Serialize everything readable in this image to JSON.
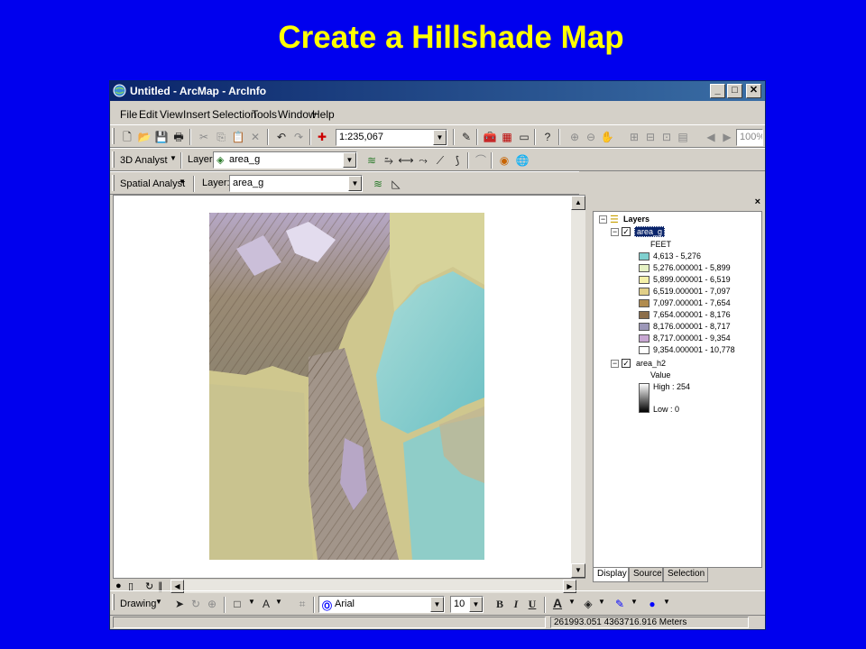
{
  "slide": {
    "title": "Create a Hillshade Map"
  },
  "window": {
    "title": "Untitled - ArcMap - ArcInfo",
    "controls": {
      "minimize": "_",
      "maximize": "□",
      "close": "✕"
    }
  },
  "menu": [
    "File",
    "Edit",
    "View",
    "Insert",
    "Selection",
    "Tools",
    "Window",
    "Help"
  ],
  "standard_toolbar": {
    "scale": "1:235,067",
    "zoom": "100%",
    "icons": [
      "new-icon",
      "open-icon",
      "save-icon",
      "print-icon",
      "cut-icon",
      "copy-icon",
      "paste-icon",
      "delete-icon",
      "undo-icon",
      "redo-icon",
      "add-data-icon",
      "editor-icon",
      "arctoolbox-icon",
      "arccatalog-icon",
      "window-icon",
      "whats-this-icon"
    ]
  },
  "analyst3d_toolbar": {
    "menu_label": "3D Analyst",
    "layer_label": "Layer:",
    "layer_value": "area_g"
  },
  "spatial_toolbar": {
    "menu_label": "Spatial Analyst",
    "layer_label": "Layer:",
    "layer_value": "area_g"
  },
  "toc": {
    "root": "Layers",
    "layers": [
      {
        "name": "area_g",
        "checked": true,
        "field": "FEET",
        "classes": [
          {
            "label": "4,613 - 5,276",
            "color": "#7fd0cf"
          },
          {
            "label": "5,276.000001 - 5,899",
            "color": "#e6f2c4"
          },
          {
            "label": "5,899.000001 - 6,519",
            "color": "#f4f0a8"
          },
          {
            "label": "6,519.000001 - 7,097",
            "color": "#e1cf88"
          },
          {
            "label": "7,097.000001 - 7,654",
            "color": "#b08b4e"
          },
          {
            "label": "7,654.000001 - 8,176",
            "color": "#8c6e4a"
          },
          {
            "label": "8,176.000001 - 8,717",
            "color": "#9c97b8"
          },
          {
            "label": "8,717.000001 - 9,354",
            "color": "#c8a7d2"
          },
          {
            "label": "9,354.000001 - 10,778",
            "color": "#ffffff"
          }
        ]
      },
      {
        "name": "area_h2",
        "checked": true,
        "field": "Value",
        "high": "High : 254",
        "low": "Low : 0"
      }
    ],
    "tabs": [
      "Display",
      "Source",
      "Selection"
    ]
  },
  "drawing_toolbar": {
    "menu_label": "Drawing",
    "font": "Arial",
    "font_size": "10",
    "bold": "B",
    "italic": "I",
    "underline": "U",
    "text_color_glyph": "A"
  },
  "status": {
    "coordinates": "261993.051  4363716.916 Meters"
  },
  "colors": {
    "slide_bg": "#0000ee",
    "title_yellow": "#ffff00",
    "window_face": "#d4d0c8",
    "titlebar": "#0a246a"
  }
}
